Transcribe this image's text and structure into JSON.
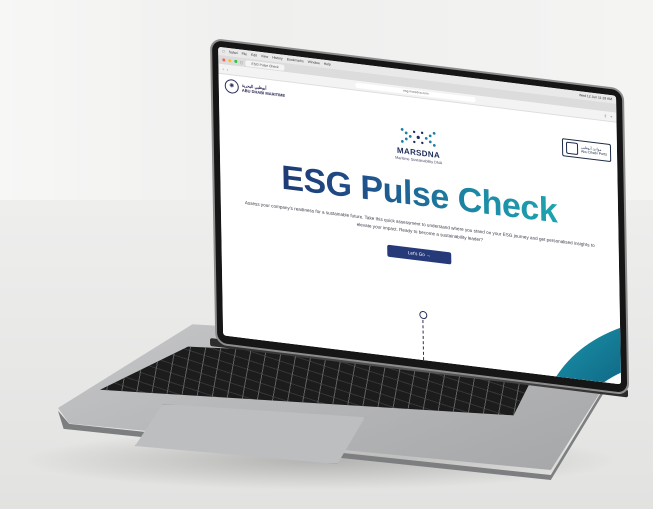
{
  "browser": {
    "menu_items": [
      "Safari",
      "File",
      "Edit",
      "View",
      "History",
      "Bookmarks",
      "Window",
      "Help"
    ],
    "status_right": "Wed 12 Jun  11:18 AM",
    "tab_label": "ESG Pulse Check",
    "url": "esg.marsdna.com"
  },
  "site": {
    "left_logo_arabic": "أبوظبي البحرية",
    "left_logo_text": "ABU DHABI MARITIME",
    "right_logo_arabic": "موانئ أبوظبي",
    "right_logo_text": "Abu Dhabi Ports",
    "brand_name": "MARSDNA",
    "brand_tagline": "Maritime Sustainability DNA",
    "title": "ESG Pulse Check",
    "description": "Assess your company's readiness for a sustainable future. Take this quick assessment to understand where you stand on your ESG journey and get personalised insights to elevate your impact. Ready to become a sustainability leader?",
    "cta_label": "Let's Go  →"
  },
  "colors": {
    "title_gradient_start": "#1e2a62",
    "title_gradient_end": "#1db9b6",
    "cta_bg": "#263a7a"
  }
}
